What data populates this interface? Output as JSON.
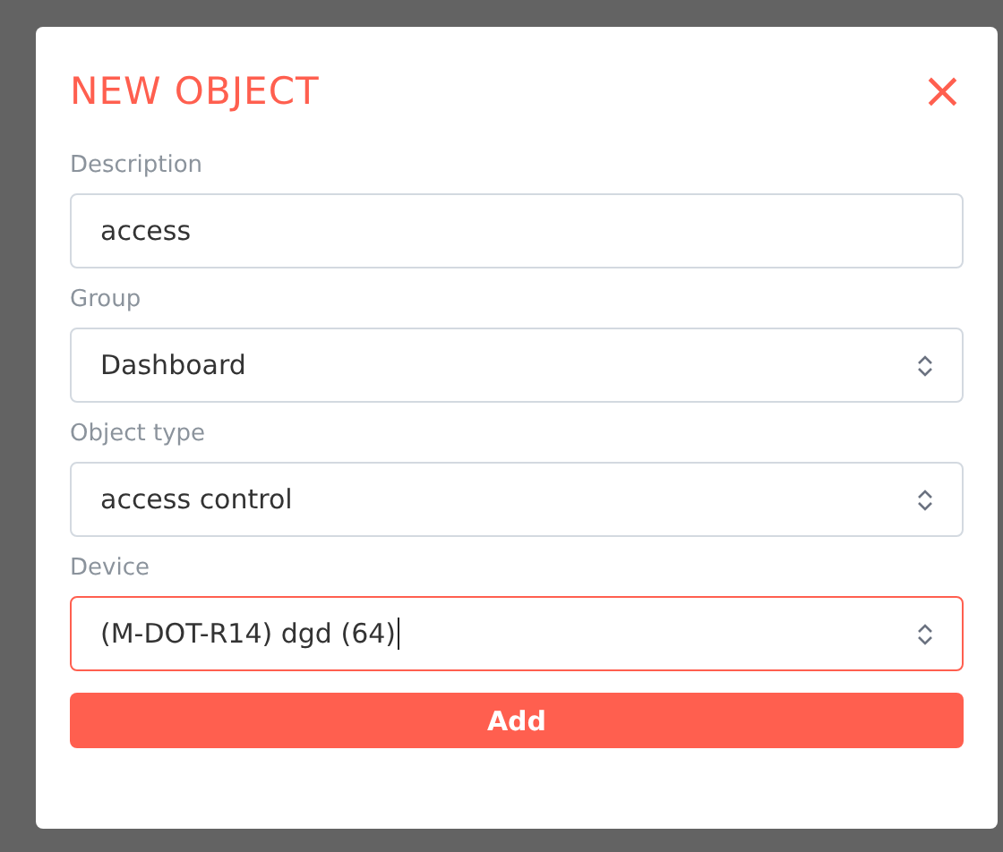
{
  "dialog": {
    "title": "NEW OBJECT",
    "close": "×",
    "fields": [
      {
        "label": "Description",
        "kind": "text",
        "value": "access",
        "focused": false
      },
      {
        "label": "Group",
        "kind": "select",
        "value": "Dashboard",
        "focused": false
      },
      {
        "label": "Object type",
        "kind": "select",
        "value": "access control",
        "focused": false
      },
      {
        "label": "Device",
        "kind": "select",
        "value": "(M-DOT-R14) dgd (64)",
        "focused": true
      }
    ],
    "submit": "Add"
  }
}
